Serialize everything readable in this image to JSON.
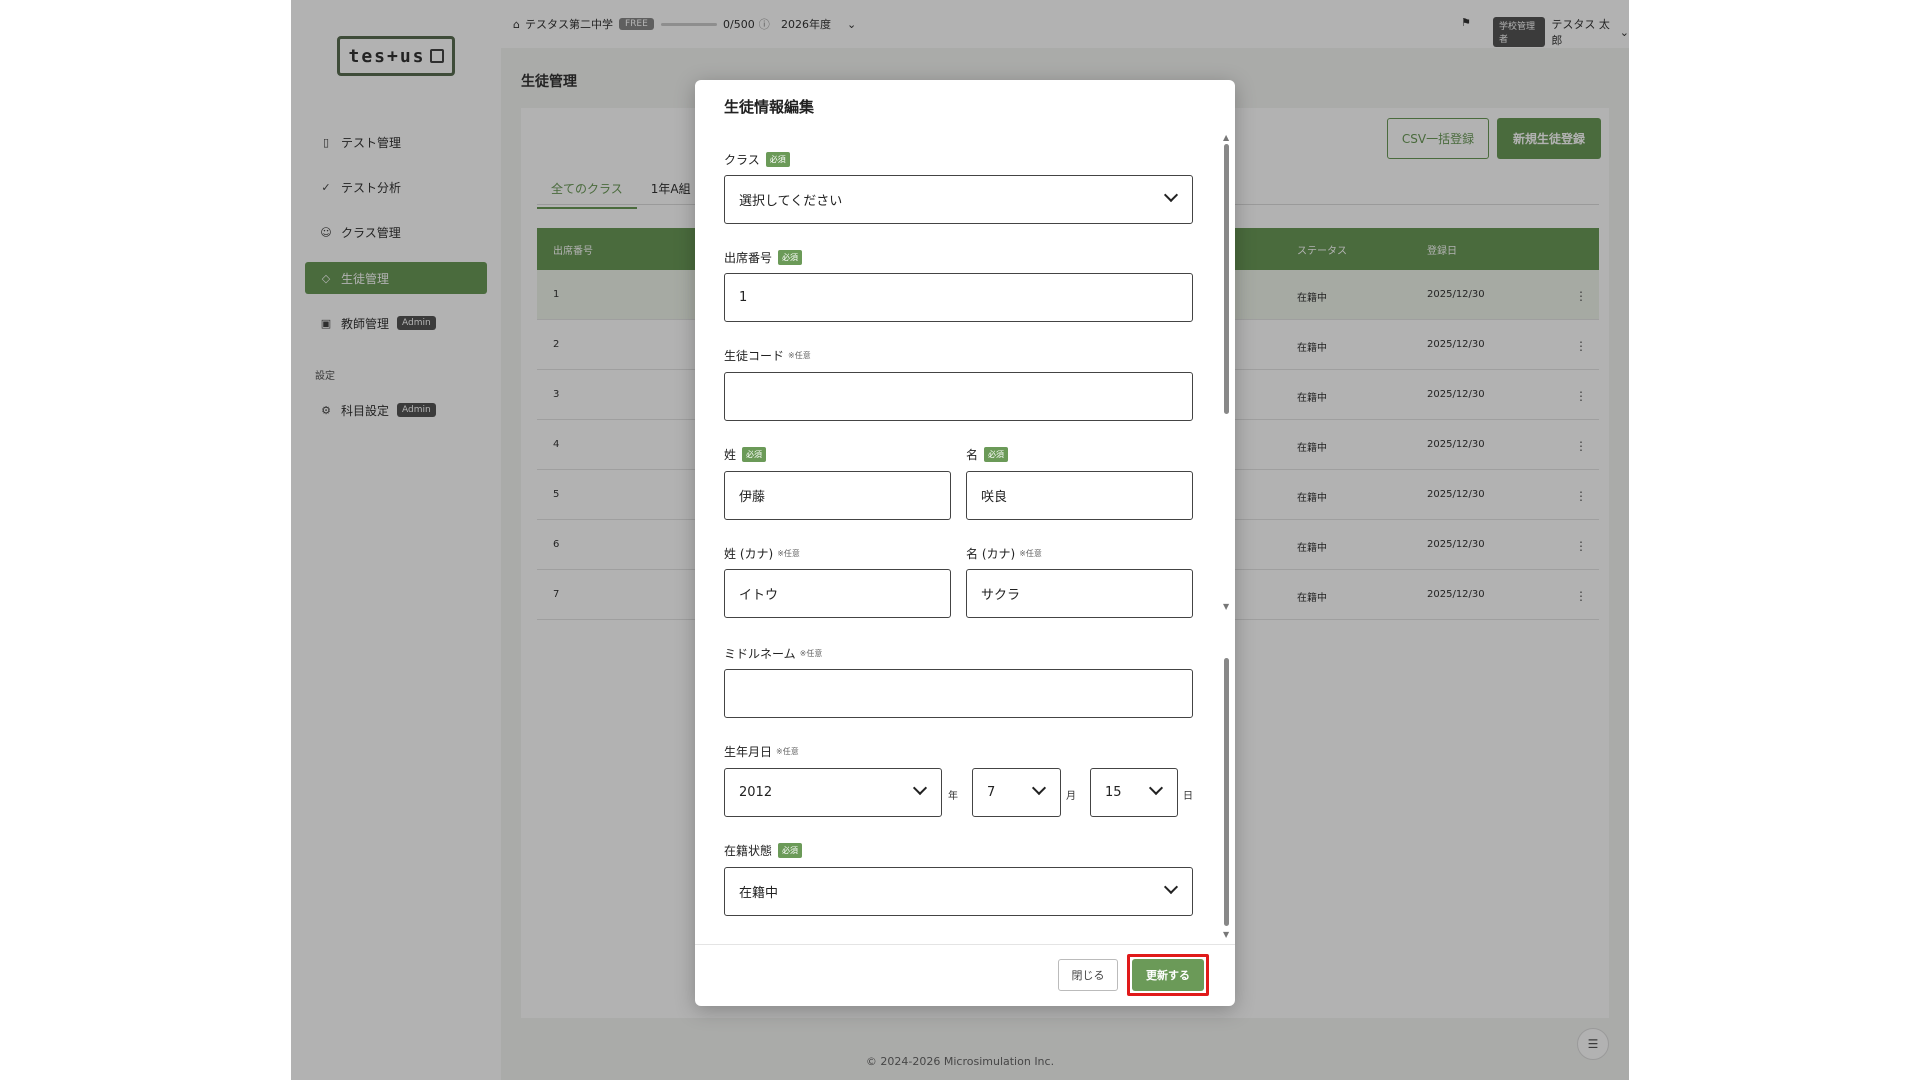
{
  "logo": "tes+us",
  "sidebar": {
    "items": [
      {
        "label": "テスト管理",
        "icon": "document-icon"
      },
      {
        "label": "テスト分析",
        "icon": "analytics-icon"
      },
      {
        "label": "クラス管理",
        "icon": "class-icon"
      },
      {
        "label": "生徒管理",
        "icon": "student-icon"
      },
      {
        "label": "教師管理",
        "icon": "teacher-icon",
        "badge": "Admin"
      }
    ],
    "section": "設定",
    "settings_items": [
      {
        "label": "科目設定",
        "icon": "gear-icon",
        "badge": "Admin"
      }
    ]
  },
  "topbar": {
    "school": "テスタス第二中学",
    "plan": "FREE",
    "usage": "0/500",
    "year": "2026年度",
    "role": "学校管理者",
    "user": "テスタス 太郎"
  },
  "main": {
    "title": "生徒管理",
    "csv_button": "CSV一括登録",
    "new_button": "新規生徒登録",
    "tabs": [
      "全てのクラス",
      "1年A組"
    ],
    "table": {
      "headers": {
        "no": "出席番号",
        "status": "ステータス",
        "date": "登録日"
      },
      "rows": [
        {
          "no": "1",
          "status": "在籍中",
          "date": "2025/12/30"
        },
        {
          "no": "2",
          "status": "在籍中",
          "date": "2025/12/30"
        },
        {
          "no": "3",
          "status": "在籍中",
          "date": "2025/12/30"
        },
        {
          "no": "4",
          "status": "在籍中",
          "date": "2025/12/30"
        },
        {
          "no": "5",
          "status": "在籍中",
          "date": "2025/12/30"
        },
        {
          "no": "6",
          "status": "在籍中",
          "date": "2025/12/30"
        },
        {
          "no": "7",
          "status": "在籍中",
          "date": "2025/12/30"
        }
      ]
    }
  },
  "footer": "© 2024-2026 Microsimulation Inc.",
  "modal": {
    "title": "生徒情報編集",
    "required": "必須",
    "optional": "※任意",
    "class": {
      "label": "クラス",
      "value": "選択してください"
    },
    "attendance_no": {
      "label": "出席番号",
      "value": "1"
    },
    "student_code": {
      "label": "生徒コード",
      "value": ""
    },
    "last_name": {
      "label": "姓",
      "value": "伊藤"
    },
    "first_name": {
      "label": "名",
      "value": "咲良"
    },
    "last_name_kana": {
      "label": "姓 (カナ)",
      "value": "イトウ"
    },
    "first_name_kana": {
      "label": "名 (カナ)",
      "value": "サクラ"
    },
    "middle_name": {
      "label": "ミドルネーム",
      "value": ""
    },
    "birthdate": {
      "label": "生年月日",
      "year": "2012",
      "year_unit": "年",
      "month": "7",
      "month_unit": "月",
      "day": "15",
      "day_unit": "日"
    },
    "enrollment": {
      "label": "在籍状態",
      "value": "在籍中"
    },
    "close_button": "閉じる",
    "update_button": "更新する"
  },
  "colors": {
    "accent": "#6b9a58",
    "highlight": "#e01a1a"
  }
}
